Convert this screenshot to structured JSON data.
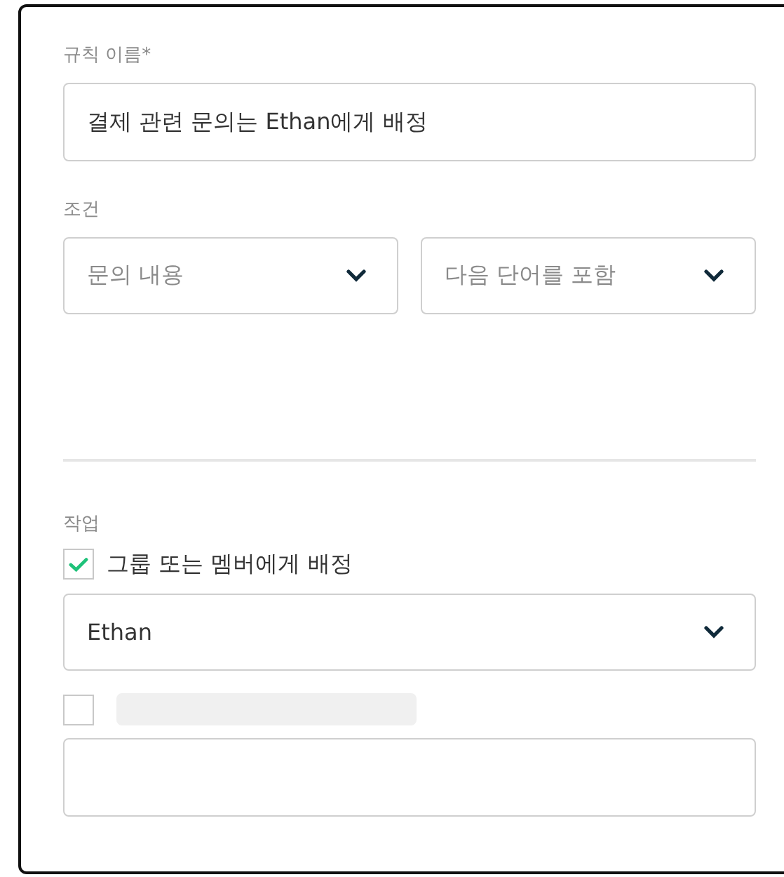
{
  "rule_name": {
    "label": "규칙 이름*",
    "value": "결제 관련 문의는 Ethan에게 배정"
  },
  "conditions": {
    "label": "조건",
    "selects": [
      {
        "value": "문의 내용"
      },
      {
        "value": "다음 단어를 포함"
      }
    ]
  },
  "actions": {
    "label": "작업",
    "items": [
      {
        "kind": "select",
        "checked": true,
        "label": "그룹 또는 멤버에게 배정",
        "value": "Ethan"
      },
      {
        "kind": "input",
        "checked": false,
        "value": ""
      }
    ]
  }
}
